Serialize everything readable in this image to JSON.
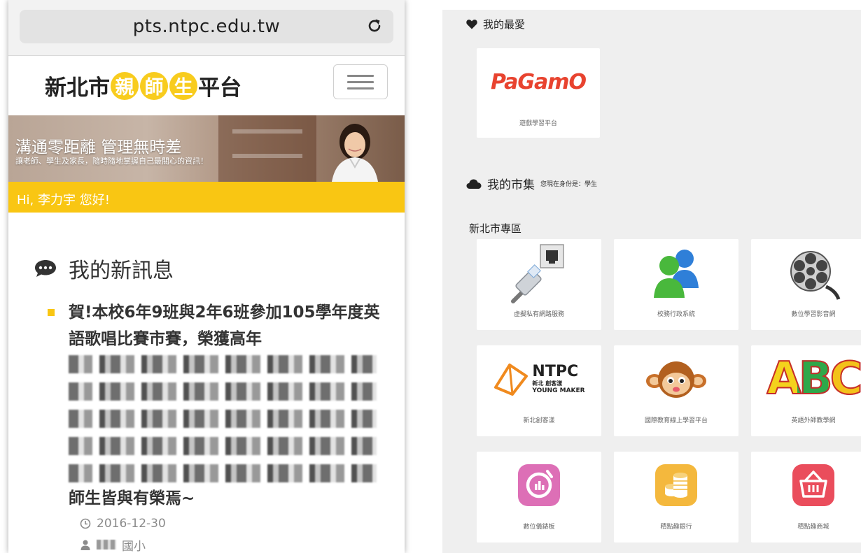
{
  "phone": {
    "url": "pts.ntpc.edu.tw",
    "logo": {
      "prefix": "新北市",
      "circles": [
        "親",
        "師",
        "生"
      ],
      "suffix": "平台"
    },
    "banner": {
      "title": "溝通零距離 管理無時差",
      "subtitle": "讓老師、學生及家長，隨時隨地掌握自己最關心的資訊！"
    },
    "greeting": "Hi, 李力宇 您好!",
    "messages": {
      "heading": "我的新訊息",
      "items": [
        {
          "title_start": "賀!本校6年9班與2年6班參加105學年度英語歌唱比賽市賽，榮獲高年",
          "title_end": "師生皆與有榮焉~",
          "date": "2016-12-30",
          "author": "國小"
        }
      ]
    }
  },
  "portal": {
    "favorites": {
      "title": "我的最愛",
      "tiles": [
        {
          "label": "遊戲學習平台",
          "icon": "pagamo-logo"
        }
      ]
    },
    "market": {
      "title": "我的市集",
      "identity_note": "您現在身份是：學生"
    },
    "ntpc_zone": {
      "title": "新北市專區",
      "tiles": [
        {
          "label": "虛擬私有網路服務",
          "icon": "network-cable-icon"
        },
        {
          "label": "校務行政系統",
          "icon": "users-icon"
        },
        {
          "label": "數位學習影音網",
          "icon": "film-reel-icon"
        },
        {
          "label": "新北創客漾",
          "icon": "ntpc-young-maker-logo"
        },
        {
          "label": "國際教育線上學習平台",
          "icon": "monkey-icon"
        },
        {
          "label": "英語外師教學網",
          "icon": "abc-icon"
        },
        {
          "label": "數位儀錶板",
          "icon": "dashboard-icon"
        },
        {
          "label": "積點趣銀行",
          "icon": "coins-icon"
        },
        {
          "label": "積點趣商城",
          "icon": "basket-icon"
        }
      ]
    },
    "logos": {
      "pagamo": "PaGamO",
      "ntpc_big": "NTPC",
      "ntpc_mid": "新北 創客漾",
      "ntpc_small": "YOUNG MAKER",
      "abc": "ABC"
    }
  },
  "colors": {
    "brand_yellow": "#f9c613",
    "pagamo_red": "#e8432f",
    "portal_bg": "#efefef"
  }
}
